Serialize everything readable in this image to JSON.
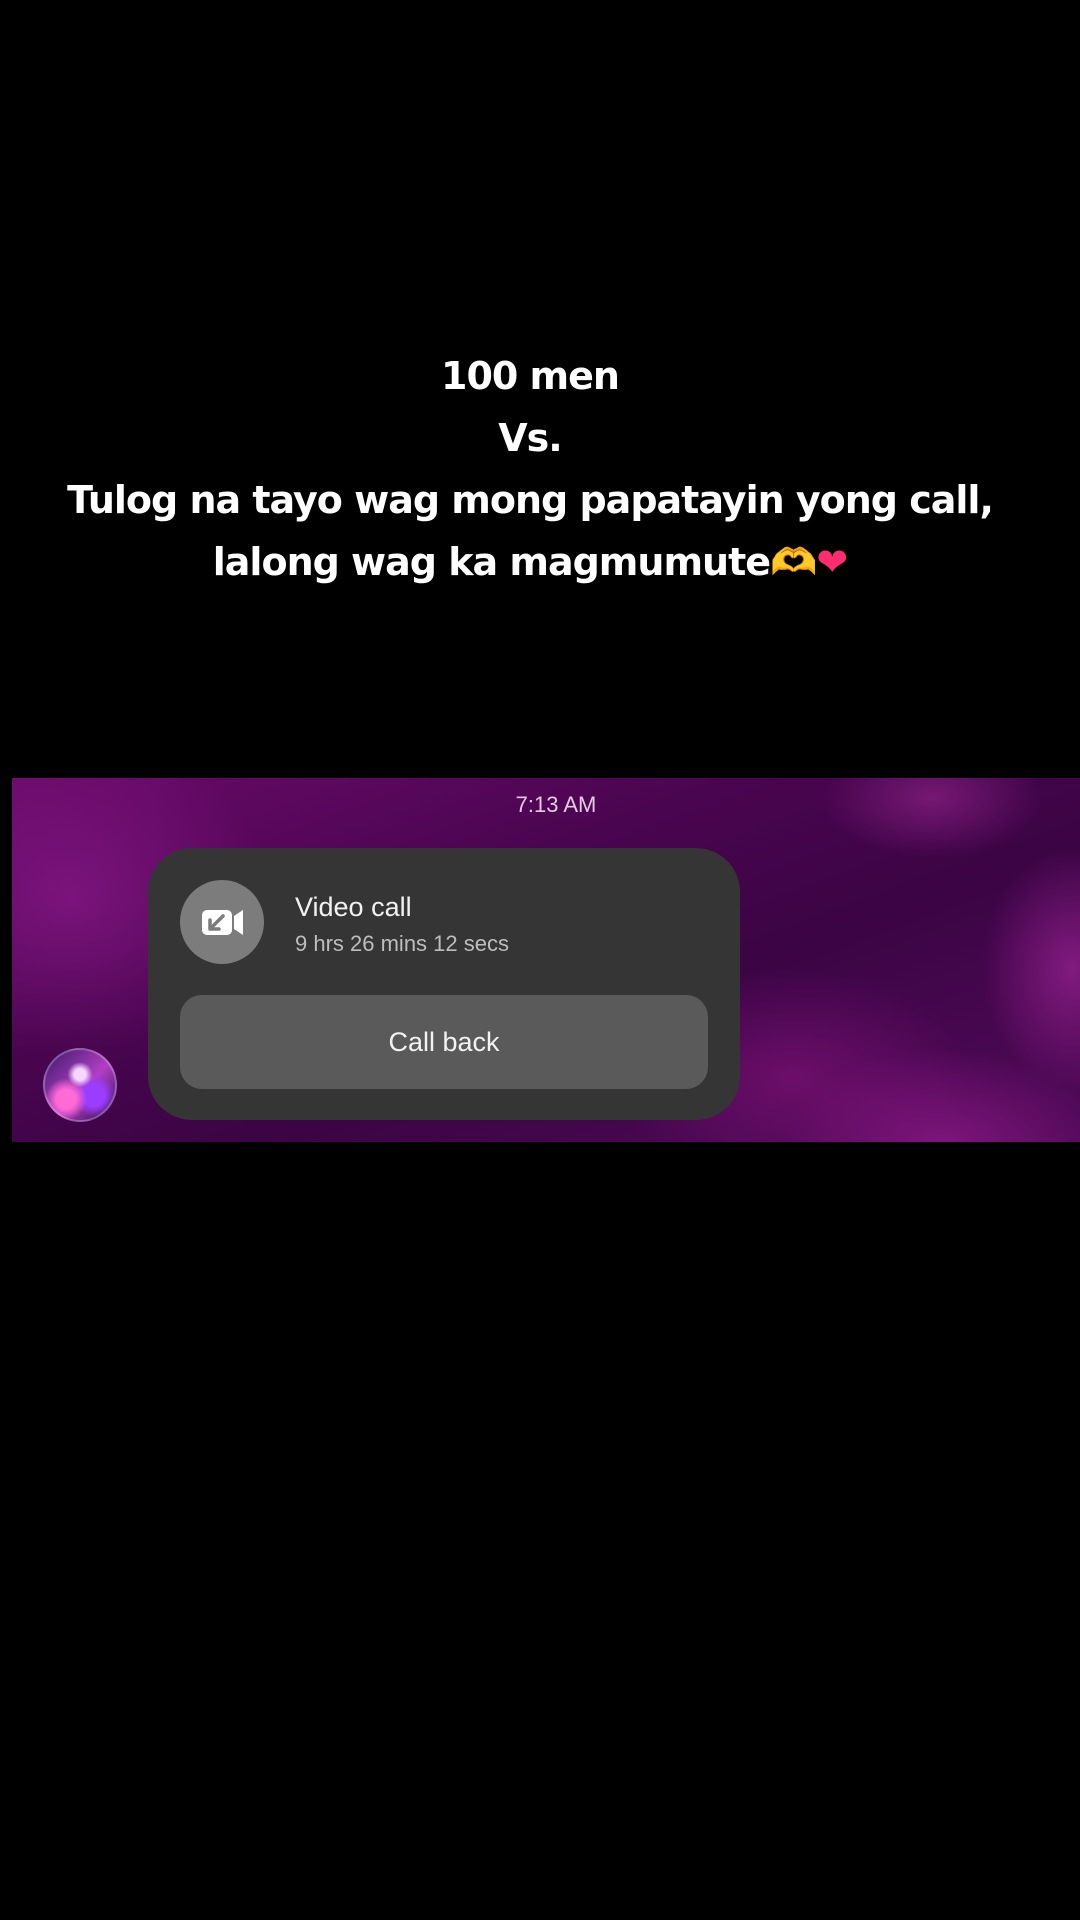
{
  "caption": {
    "line1": "100 men",
    "line2": "Vs.",
    "line3": "Tulog na tayo wag mong papatayin yong call,",
    "line4": "lalong wag ka magmumute",
    "emoji_hands": "🫶",
    "emoji_heart": "❤"
  },
  "chat": {
    "timestamp": "7:13 AM",
    "call": {
      "icon": "video-call-incoming-icon",
      "title": "Video call",
      "duration": "9 hrs 26 mins 12 secs",
      "action_label": "Call back"
    },
    "colors": {
      "background": "#4a0550",
      "bubble": "#353535",
      "button": "#5a5a5a"
    }
  }
}
